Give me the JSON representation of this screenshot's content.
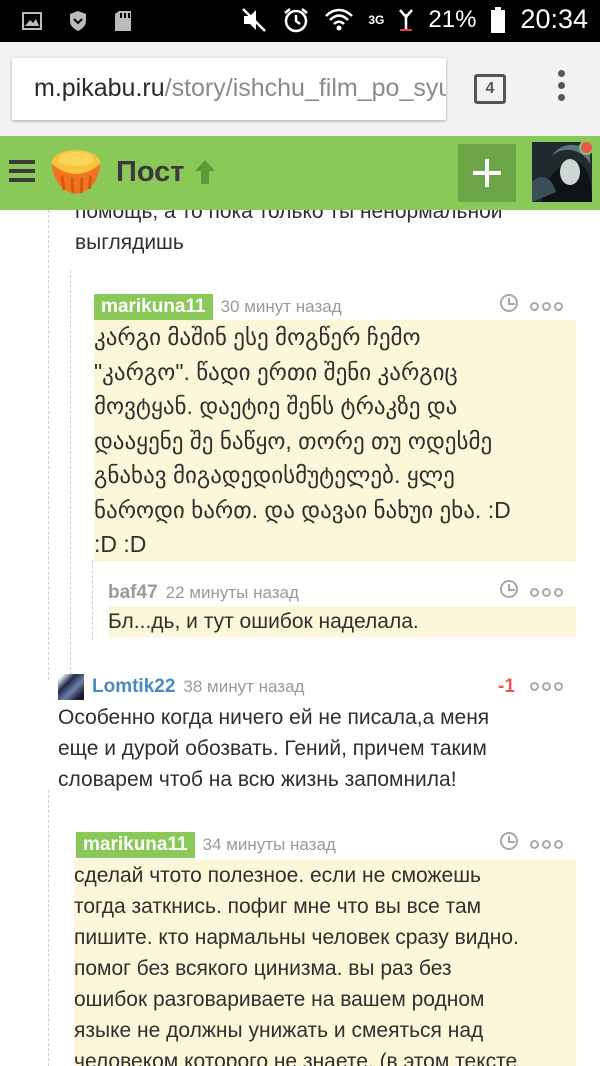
{
  "status_bar": {
    "battery_percent": "21%",
    "time": "20:34",
    "network": "3G"
  },
  "browser": {
    "url_host": "m.pikabu.ru",
    "url_path": "/story/ishchu_film_po_syu",
    "tab_count": "4"
  },
  "header": {
    "title": "Пост",
    "colors": {
      "bar": "#8ac858",
      "plus_button": "#6ca547"
    }
  },
  "comments": [
    {
      "id": "c0",
      "text_lines": [
        "помощь, а то пока только ты ненормальной",
        "выглядишь"
      ]
    },
    {
      "id": "c1",
      "author": "marikuna11",
      "time": "30 минут назад",
      "text_lines": [
        "კარგი მაშინ ესე მოგწერ ჩემო",
        "\"კარგო\".  წადი ერთი შენი კარგიც",
        "მოვტყან. დაეტიე შენს ტრაკზე და",
        "დააყენე შე ნაწყო, თორე თუ ოდესმე",
        "გნახავ მიგადედისმუტელებ. ყლე",
        "ნაროდი ხართ.  და დავაი ნახუი ეხა. :D",
        ":D :D"
      ]
    },
    {
      "id": "c2",
      "author": "baf47",
      "time": "22 минуты назад",
      "text_lines": [
        "Бл...дь, и тут ошибок наделала."
      ]
    },
    {
      "id": "c3",
      "author": "Lomtik22",
      "time": "38 минут назад",
      "rating": "-1",
      "text_lines": [
        "Особенно когда ничего ей не писала,а меня",
        "еще и дурой обозвать. Гений, причем таким",
        "словарем чтоб на всю жизнь запомнила!"
      ]
    },
    {
      "id": "c4",
      "author": "marikuna11",
      "time": "34 минуты назад",
      "text_lines": [
        "сделай чтото полезное. если не сможешь",
        "тогда заткнись. пофиг мне что вы все там",
        "пишите. кто нармальны человек сразу видно.",
        "помог без всякого цинизма. вы раз без",
        "ошибок разговариваете на вашем родном",
        "языке не должны унижать и смеяться над",
        "человеком которого не знаете. (в этом тексте"
      ]
    }
  ]
}
